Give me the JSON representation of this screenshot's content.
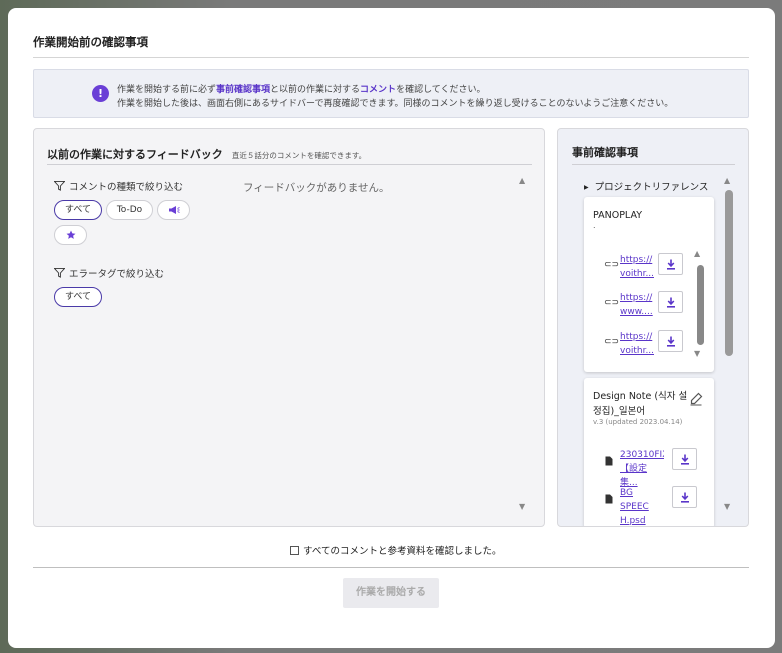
{
  "modal": {
    "title": "作業開始前の確認事項"
  },
  "notice": {
    "line1_a": "作業を開始する前に必ず",
    "line1_b": "事前確認事項",
    "line1_c": "と以前の作業に対する",
    "line1_d": "コメント",
    "line1_e": "を確認してください。",
    "line2": "作業を開始した後は、画面右側にあるサイドバーで再度確認できます。同様のコメントを繰り返し受けることのないようご注意ください。"
  },
  "feedback": {
    "title": "以前の作業に対するフィードバック",
    "subtitle": "直近５話分のコメントを確認できます。",
    "filter_type_label": "コメントの種類で絞り込む",
    "type_chips": [
      "すべて",
      "To-Do"
    ],
    "filter_error_label": "エラータグで絞り込む",
    "error_chips": [
      "すべて"
    ],
    "empty_text": "フィードバックがありません。"
  },
  "precheck": {
    "title": "事前確認事項",
    "project_ref": "プロジェクトリファレンス",
    "card1": {
      "name": "PANOPLAY",
      "dot": ".",
      "links": [
        {
          "line1": "https://",
          "line2": "voithr..."
        },
        {
          "line1": "https://",
          "line2": "www...."
        },
        {
          "line1": "https://",
          "line2": "voithr..."
        }
      ]
    },
    "card2": {
      "name_line1": "Design Note (식자 설",
      "name_line2": "정집)_일본어",
      "version": "v.3 (updated 2023.04.14)",
      "files": [
        {
          "line1": "230310FIX",
          "line2": "【設定集..."
        },
        {
          "line1": "BG SPEEC",
          "line2": "H.psd"
        }
      ]
    }
  },
  "footer": {
    "confirm_label": "すべてのコメントと参考資料を確認しました。",
    "start_button": "作業を開始する"
  },
  "colors": {
    "accent": "#6a3fd6",
    "link": "#5a35c9"
  }
}
